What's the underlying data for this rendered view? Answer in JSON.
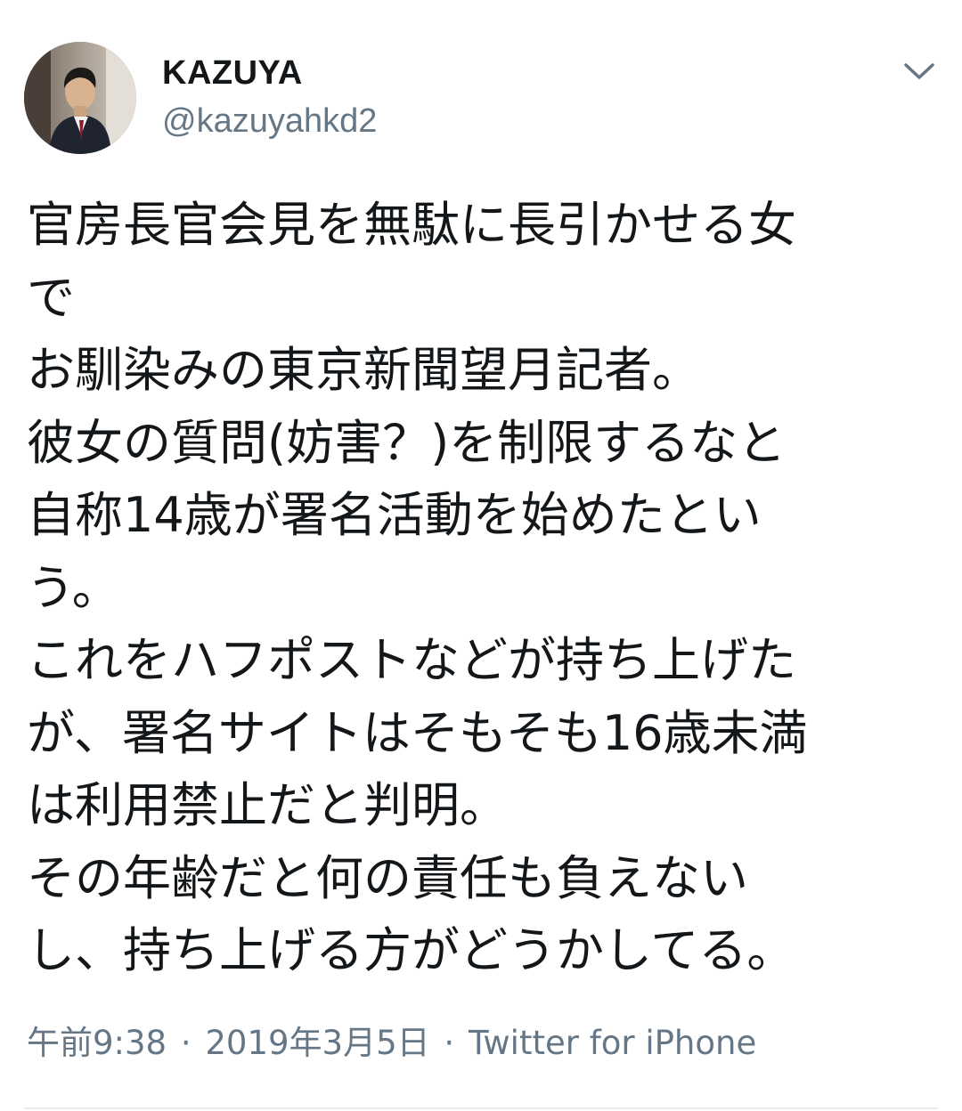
{
  "tweet": {
    "author": {
      "display_name": "KAZUYA",
      "handle": "@kazuyahkd2",
      "avatar": "profile-photo"
    },
    "menu_icon": "chevron-down-icon",
    "text_lines": [
      "官房長官会見を無駄に長引かせる女",
      "で",
      "お馴染みの東京新聞望月記者。",
      "彼女の質問(妨害？)を制限するなと",
      "自称14歳が署名活動を始めたとい",
      "う。",
      "これをハフポストなどが持ち上げた",
      "が、署名サイトはそもそも16歳未満",
      "は利用禁止だと判明。",
      "その年齢だと何の責任も負えない",
      "し、持ち上げる方がどうかしてる。"
    ],
    "time": "午前9:38",
    "date": "2019年3月5日",
    "source": "Twitter for iPhone",
    "separator": "·"
  },
  "colors": {
    "text": "#14171a",
    "secondary": "#657786",
    "divider": "#e6ecf0"
  }
}
